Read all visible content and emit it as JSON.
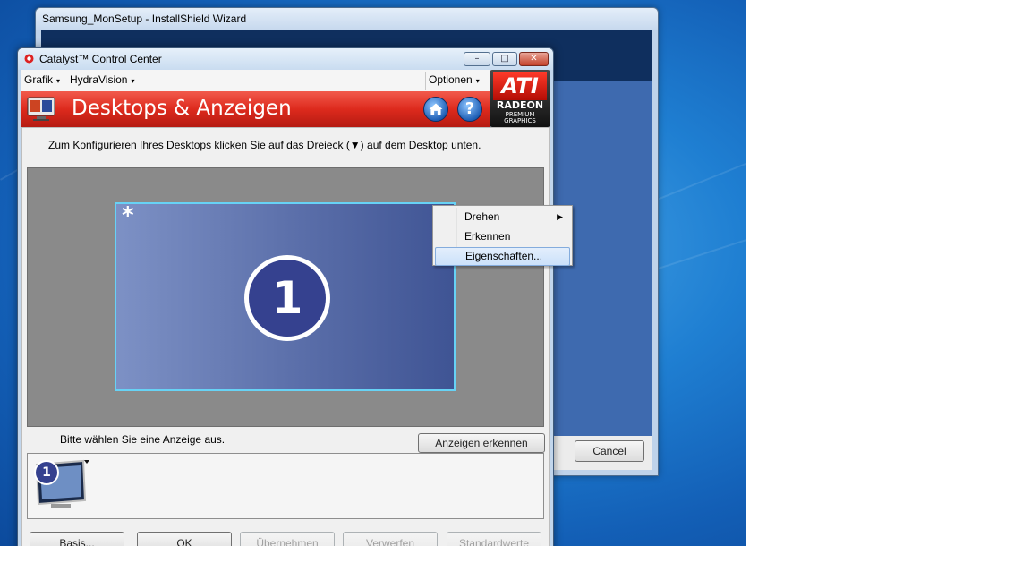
{
  "back_window": {
    "title": "Samsung_MonSetup - InstallShield Wizard",
    "cancel_label": "Cancel"
  },
  "catalyst": {
    "title": "Catalyst™ Control Center",
    "window_controls": {
      "minimize": "–",
      "maximize": "□",
      "close": "✕"
    },
    "menu": {
      "grafik": "Grafik",
      "hydravision": "HydraVision",
      "optionen": "Optionen",
      "caret": "▾"
    },
    "banner": {
      "title": "Desktops & Anzeigen",
      "home_icon": "home-icon",
      "help_glyph": "?"
    },
    "logo": {
      "brand": "ATI",
      "product": "RADEON",
      "tagline_1": "PREMIUM",
      "tagline_2": "GRAPHICS"
    },
    "instruction": "Zum Konfigurieren Ihres Desktops klicken Sie auf das Dreieck (▼) auf dem Desktop unten.",
    "monitor": {
      "primary_marker": "*",
      "number": "1"
    },
    "select_display_label": "Bitte wählen Sie eine Anzeige aus.",
    "detect_button": "Anzeigen erkennen",
    "thumbnail_number": "1",
    "bottom_buttons": {
      "basis": "Basis...",
      "ok": "OK",
      "apply": "Übernehmen",
      "discard": "Verwerfen",
      "defaults": "Standardwerte"
    }
  },
  "context_menu": {
    "items": [
      {
        "label": "Drehen",
        "submenu": "▶"
      },
      {
        "label": "Erkennen"
      },
      {
        "label": "Eigenschaften..."
      }
    ]
  },
  "colors": {
    "banner_red": "#dd2a1d",
    "selection_border": "#67d2f5",
    "monitor_badge": "#35418f"
  }
}
